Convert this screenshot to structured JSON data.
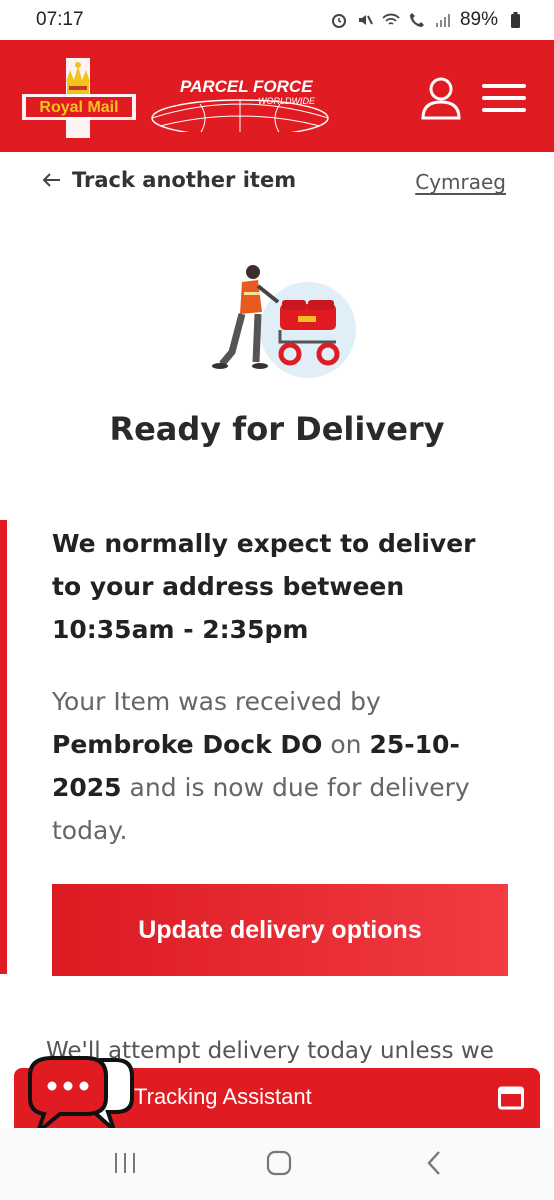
{
  "status_bar": {
    "time": "07:17",
    "battery": "89%"
  },
  "header": {
    "royal_mail_logo_text": "Royal Mail",
    "parcelforce_logo_text": "PARCEL FORCE",
    "parcelforce_logo_subtext": "WORLDWIDE",
    "brand_color": "#e11b22"
  },
  "nav": {
    "back_label": "Track another item",
    "language_label": "Cymraeg"
  },
  "tracking": {
    "status_title": "Ready for Delivery",
    "expectation_text": "We normally expect to deliver to your address between 10:35am - 2:35pm",
    "received_prefix": "Your Item was received by ",
    "received_location": "Pembroke Dock DO",
    "received_on": " on ",
    "received_date": "25-10-2025",
    "received_suffix": " and is now due for delivery today.",
    "update_button_label": "Update delivery options",
    "partial_text": "We'll attempt delivery today unless we"
  },
  "assistant": {
    "label": "Tracking Assistant"
  },
  "icons": {
    "account": "user-icon",
    "menu": "hamburger-icon",
    "back": "arrow-left-icon",
    "chat": "chat-bubbles-icon",
    "expand": "window-icon"
  }
}
